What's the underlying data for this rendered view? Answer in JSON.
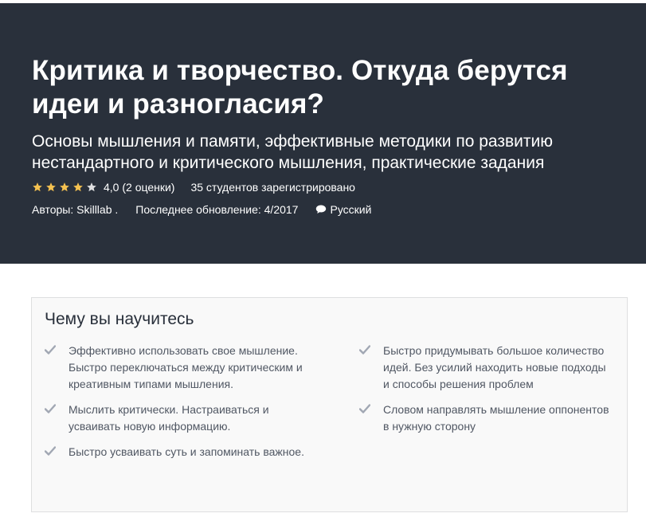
{
  "course": {
    "title": "Критика и творчество. Откуда берутся идеи и разногласия?",
    "subtitle": "Основы мышления и памяти, эффективные методики по развитию нестандартного и критического мышления, практические задания",
    "rating": {
      "stars_filled": 4,
      "stars_total": 5,
      "text": "4,0 (2 оценки)",
      "enrolled": "35 студентов зарегистрировано"
    },
    "meta": {
      "authors": "Авторы: Skilllab .",
      "updated": "Последнее обновление: 4/2017",
      "language": "Русский"
    }
  },
  "learn": {
    "heading": "Чему вы научитесь",
    "left": [
      "Эффективно использовать свое мышление. Быстро переключаться между критическим и креативным типами мышления.",
      "Мыслить критически. Настраиваться и усваивать новую информацию.",
      "Быстро усваивать суть и запоминать важное."
    ],
    "right": [
      "Быстро придумывать большое количество идей. Без усилий находить новые подходы и способы решения проблем",
      "Словом направлять мышление оппонентов в нужную сторону"
    ]
  },
  "colors": {
    "hero_bg": "#29303b",
    "star_filled": "#f4c150",
    "star_empty": "#dedfe0",
    "check": "#a1a7b3"
  },
  "icons": {
    "star": "star-icon",
    "comment": "comment-icon",
    "check": "check-icon"
  }
}
